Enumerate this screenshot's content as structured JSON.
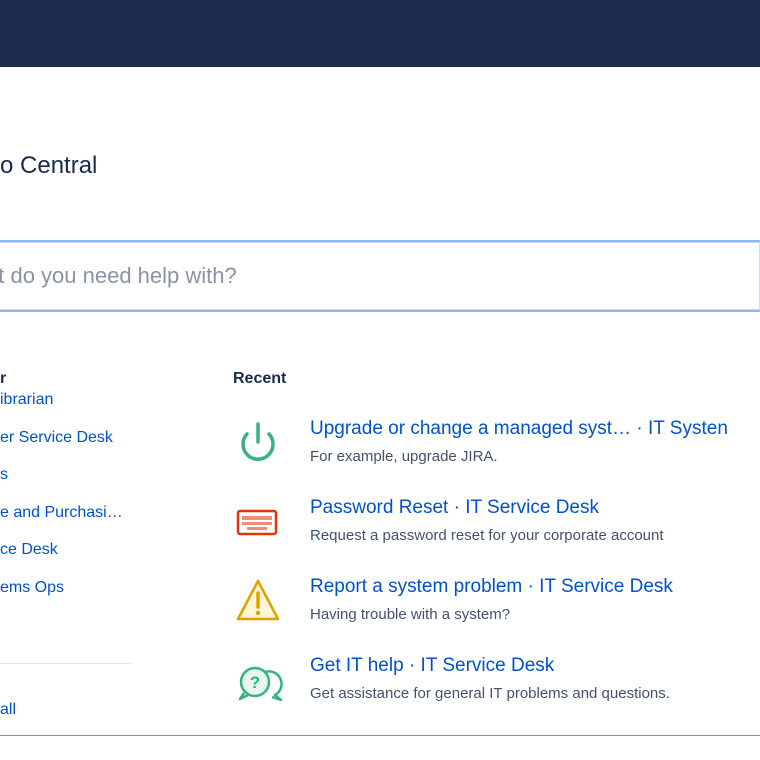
{
  "portal": {
    "title": "o Central"
  },
  "search": {
    "placeholder": "at do you need help with?"
  },
  "left_panel": {
    "heading": "r",
    "items": [
      {
        "label": "ibrarian"
      },
      {
        "label": "er Service Desk"
      },
      {
        "label": "s"
      },
      {
        "label": "e and Purchasi…"
      },
      {
        "label": "ce Desk"
      },
      {
        "label": "ems Ops"
      }
    ],
    "view_all": "all"
  },
  "recent": {
    "heading": "Recent",
    "items": [
      {
        "title": "Upgrade or change a managed syst…",
        "separator": "·",
        "project": "IT Systen",
        "description": "For example, upgrade JIRA.",
        "icon": "power-icon",
        "color": "#36b37e"
      },
      {
        "title": "Password Reset",
        "separator": "·",
        "project": "IT Service Desk",
        "description": "Request a password reset for your corporate account",
        "icon": "keyboard-icon",
        "color": "#de350b"
      },
      {
        "title": "Report a system problem",
        "separator": "·",
        "project": "IT Service Desk",
        "description": "Having trouble with a system?",
        "icon": "warning-icon",
        "color": "#e2a000"
      },
      {
        "title": "Get IT help",
        "separator": "·",
        "project": "IT Service Desk",
        "description": "Get assistance for general IT problems and questions.",
        "icon": "question-chat-icon",
        "color": "#36b37e"
      }
    ]
  },
  "colors": {
    "topbar": "#1b2a4e",
    "link": "#0052cc",
    "search_border": "#8db6f1"
  }
}
